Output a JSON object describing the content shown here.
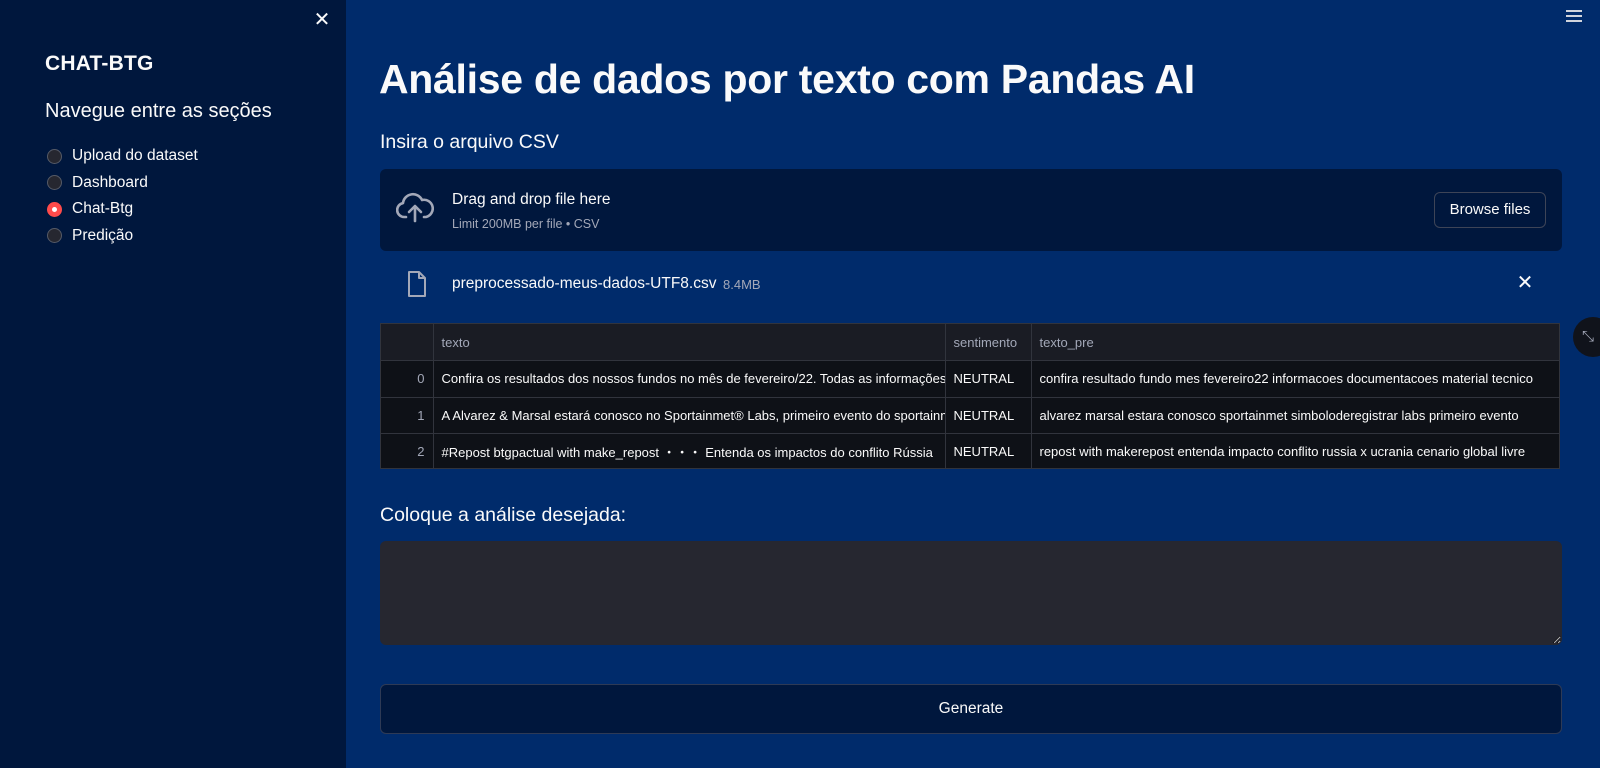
{
  "sidebar": {
    "close_icon": "✕",
    "title": "CHAT-BTG",
    "subtitle": "Navegue entre as seções",
    "items": [
      {
        "label": "Upload do dataset",
        "selected": false
      },
      {
        "label": "Dashboard",
        "selected": false
      },
      {
        "label": "Chat-Btg",
        "selected": true
      },
      {
        "label": "Predição",
        "selected": false
      }
    ]
  },
  "main": {
    "title": "Análise de dados por texto com Pandas AI",
    "upload_label": "Insira o arquivo CSV",
    "dropzone": {
      "main_text": "Drag and drop file here",
      "sub_text": "Limit 200MB per file • CSV",
      "browse_label": "Browse files"
    },
    "file": {
      "name": "preprocessado-meus-dados-UTF8.csv",
      "size": "8.4MB",
      "remove_icon": "✕"
    },
    "table": {
      "columns": [
        "",
        "texto",
        "sentimento",
        "texto_pre"
      ],
      "rows": [
        [
          "0",
          "Confira os resultados dos nossos fundos no mês de fevereiro/22. Todas as informações",
          "NEUTRAL",
          "confira resultado fundo mes fevereiro22 informacoes documentacoes material tecnico"
        ],
        [
          "1",
          "A Alvarez & Marsal estará conosco no Sportainmet® Labs, primeiro evento do sportainment",
          "NEUTRAL",
          "alvarez marsal estara conosco sportainmet simboloderegistrar labs primeiro evento"
        ],
        [
          "2",
          "#Repost btgpactual with make_repost ・・・ Entenda os impactos do conflito Rússia",
          "NEUTRAL",
          "repost with makerepost entenda impacto conflito russia x ucrania cenario global livre"
        ]
      ]
    },
    "analysis_label": "Coloque a análise desejada:",
    "analysis_value": "",
    "generate_label": "Generate",
    "expand_icon": "⤡"
  },
  "colors": {
    "sidebar_bg": "#00173d",
    "main_bg": "#002b6b",
    "accent_radio": "#ff4b4b"
  }
}
